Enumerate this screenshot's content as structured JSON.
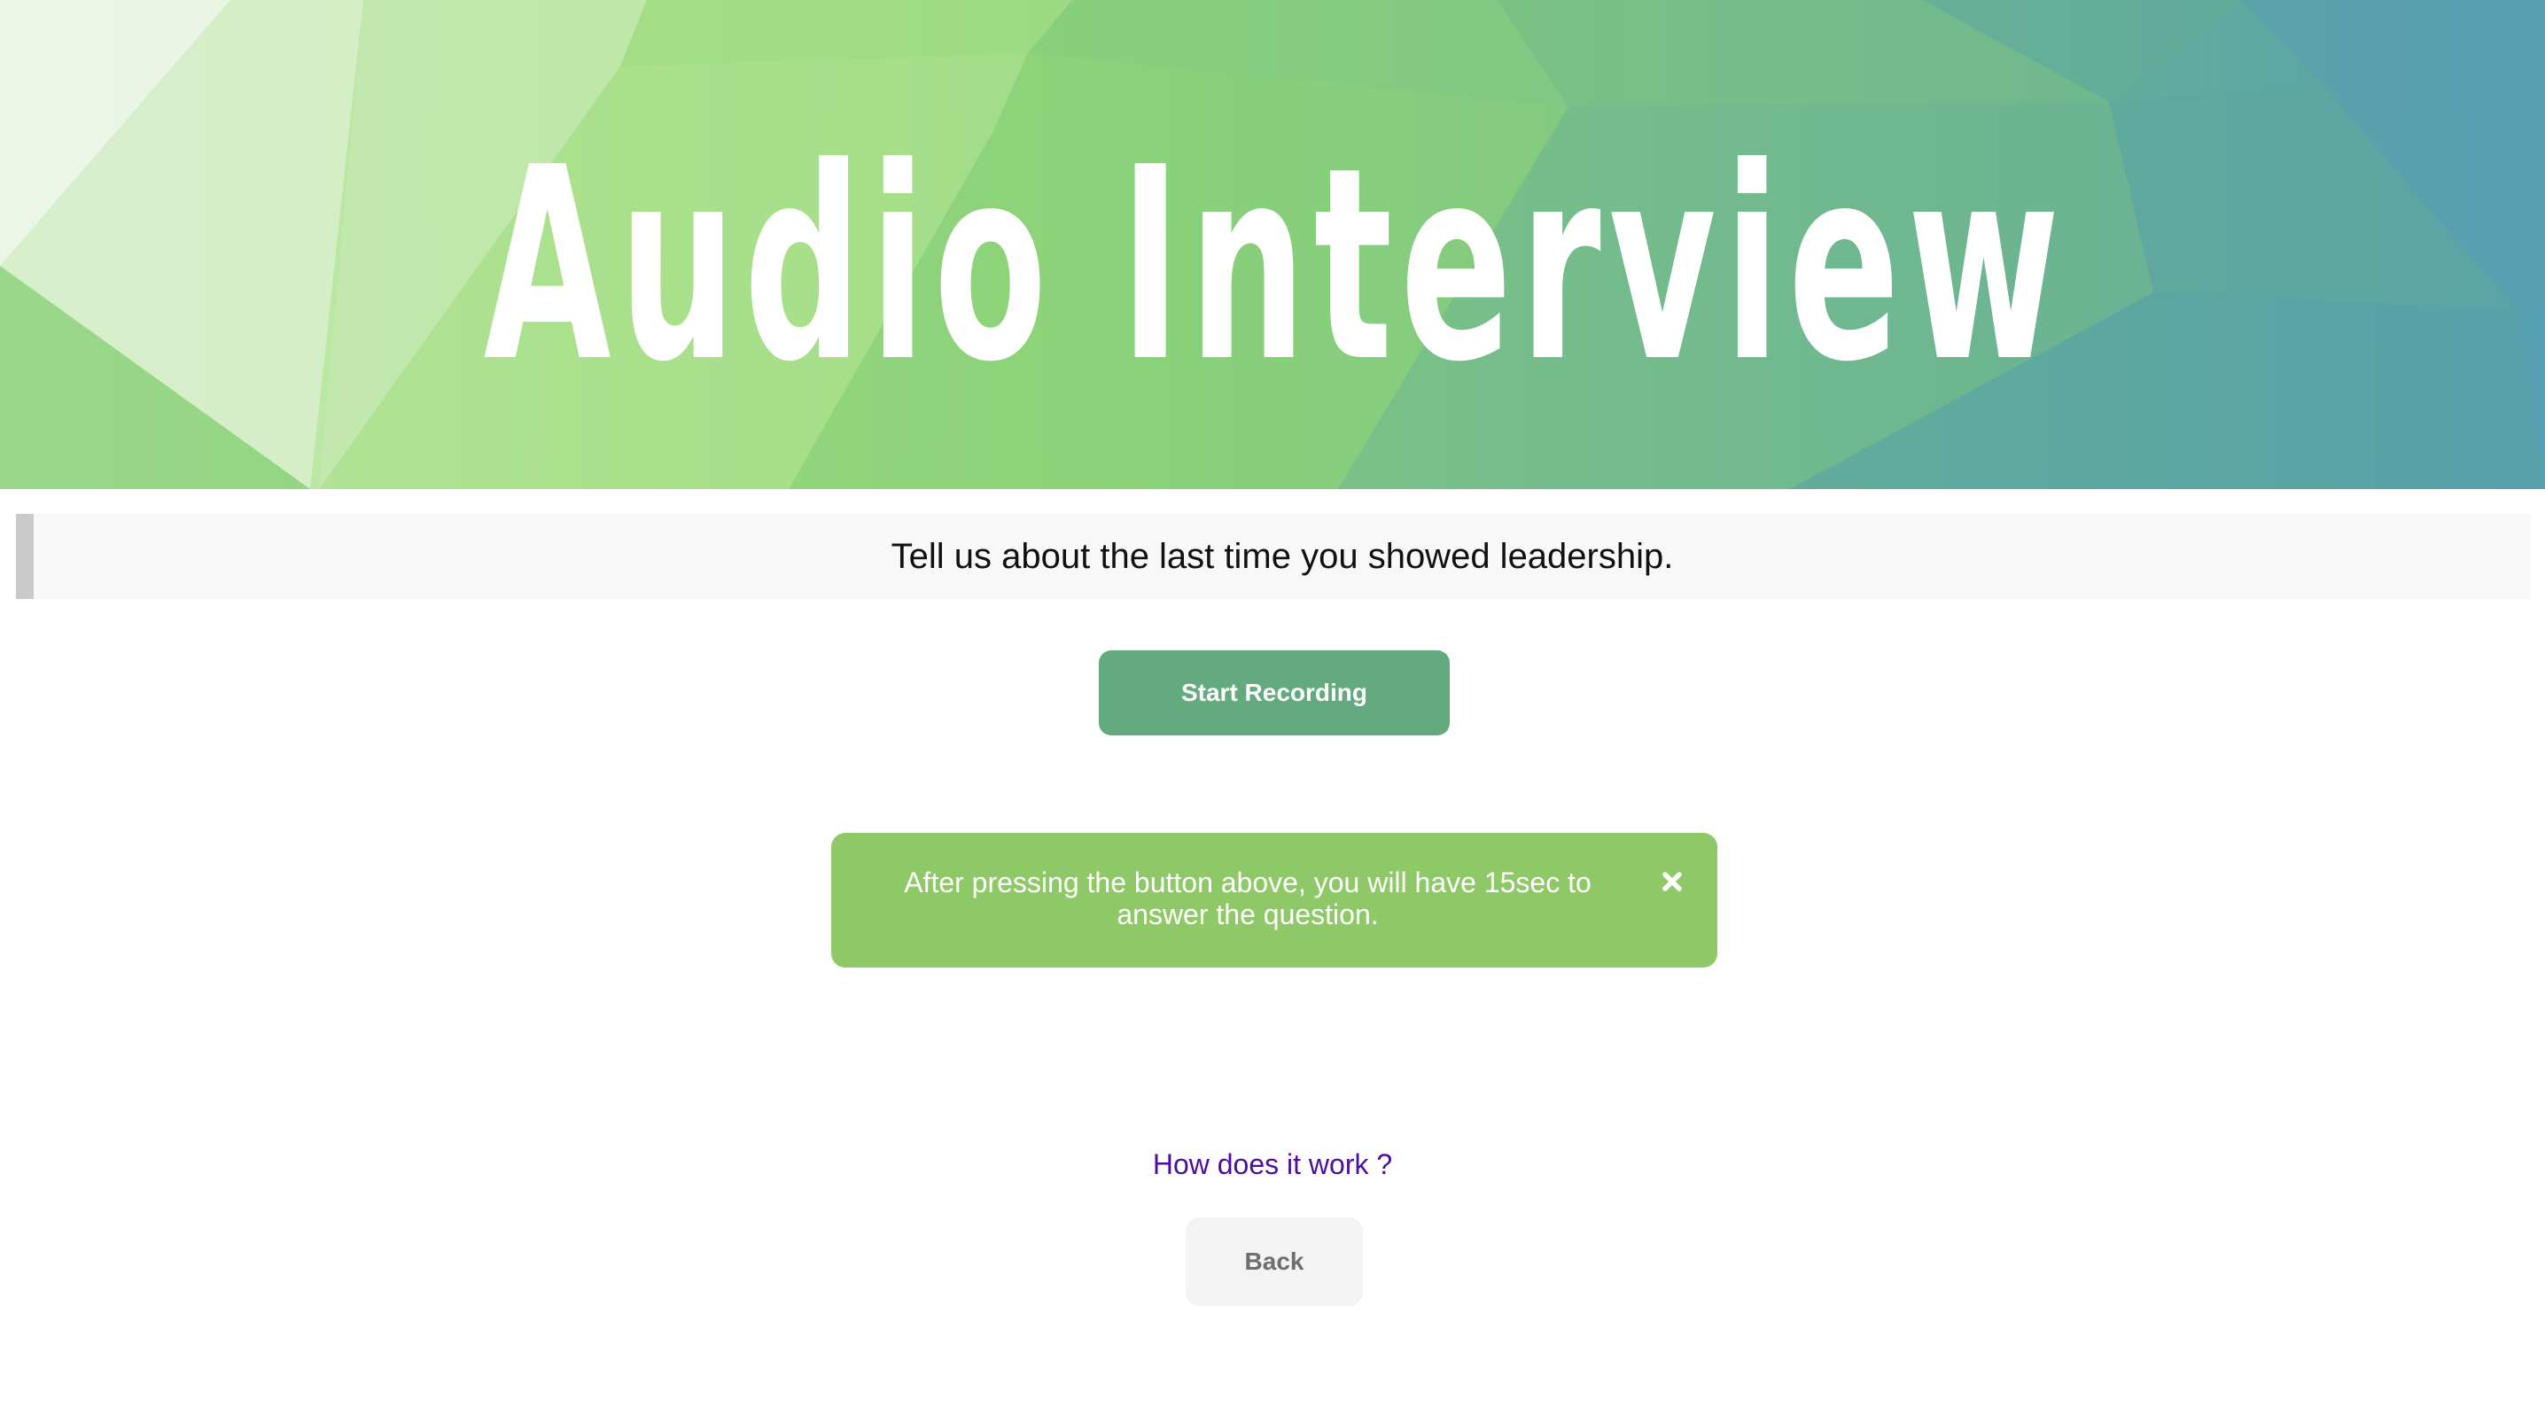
{
  "banner": {
    "title": "Audio Interview"
  },
  "question": {
    "text": "Tell us about the last time you showed leadership."
  },
  "recording": {
    "start_label": "Start Recording"
  },
  "notice": {
    "message": "After pressing the button above, you will have 15sec to answer the question.",
    "close_icon": "close-icon"
  },
  "help": {
    "link_text": "How does it work ?"
  },
  "navigation": {
    "back_label": "Back"
  },
  "colors": {
    "start_button": "#63ab7e",
    "notice_background": "#8fc866",
    "link": "#4a0f9e",
    "back_button": "#f3f3f3"
  }
}
